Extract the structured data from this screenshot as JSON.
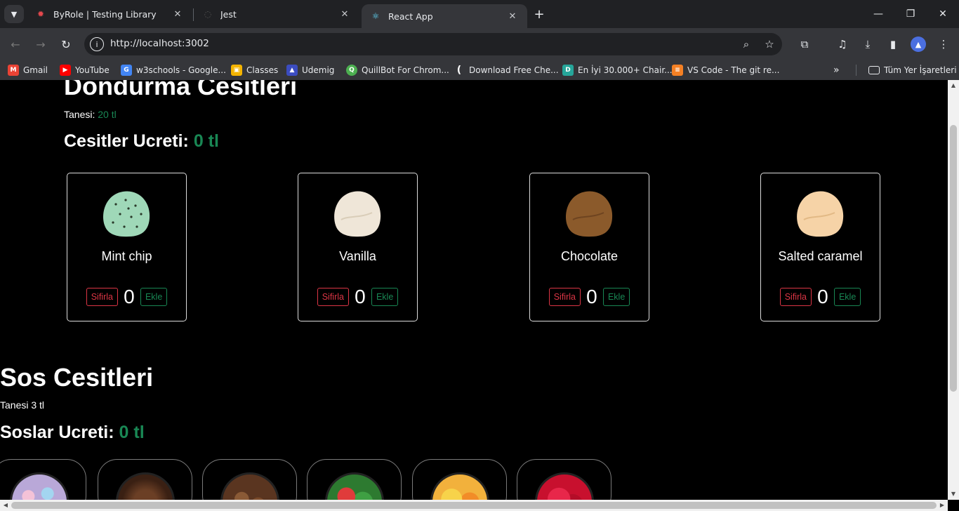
{
  "browser": {
    "tabs": [
      {
        "title": "ByRole | Testing Library",
        "favicon": "octopus-icon"
      },
      {
        "title": "Jest",
        "favicon": "jest-icon"
      },
      {
        "title": "React App",
        "favicon": "react-icon"
      }
    ],
    "url": "http://localhost:3002",
    "bookmarks": [
      {
        "label": "Gmail",
        "color": "#ea4335"
      },
      {
        "label": "YouTube",
        "color": "#ff0000"
      },
      {
        "label": "w3schools - Google...",
        "color": "#4285f4"
      },
      {
        "label": "Classes",
        "color": "#f4b400"
      },
      {
        "label": "Udemig",
        "color": "#3b4cc0"
      },
      {
        "label": "QuillBot For Chrom...",
        "color": "#4caf50"
      },
      {
        "label": "Download Free Che...",
        "color": "#35363a"
      },
      {
        "label": "En İyi 30.000+ Chair...",
        "color": "#26a69a"
      },
      {
        "label": "VS Code - The git re...",
        "color": "#f48024"
      }
    ],
    "all_bookmarks": "Tüm Yer İşaretleri"
  },
  "ice_cream": {
    "heading": "Dondurma Cesitleri",
    "unit_label": "Tanesi:",
    "unit_price": "20 tl",
    "total_label": "Cesitler Ucreti:",
    "total_value": "0 tl",
    "flavors": [
      {
        "name": "Mint chip",
        "count": "0",
        "color": "#9fd8b8",
        "chip": "#2a4a2a"
      },
      {
        "name": "Vanilla",
        "count": "0",
        "color": "#efe6d8",
        "chip": ""
      },
      {
        "name": "Chocolate",
        "count": "0",
        "color": "#8b5a2b",
        "chip": ""
      },
      {
        "name": "Salted caramel",
        "count": "0",
        "color": "#f6d3a7",
        "chip": ""
      }
    ],
    "reset_label": "Sifirla",
    "add_label": "Ekle"
  },
  "sauces": {
    "heading": "Sos Cesitleri",
    "unit_text": "Tanesi 3 tl",
    "total_label": "Soslar Ucreti:",
    "total_value": "0 tl",
    "items": [
      {
        "name": "candy-topping",
        "color": "#b9a8d8"
      },
      {
        "name": "chocolate-topping",
        "color": "#4a2b1c"
      },
      {
        "name": "choc-chips-topping",
        "color": "#6b4328"
      },
      {
        "name": "gummy-topping",
        "color": "#3fa043"
      },
      {
        "name": "jelly-topping",
        "color": "#f2b13c"
      },
      {
        "name": "cherry-topping",
        "color": "#c8102e"
      }
    ]
  }
}
